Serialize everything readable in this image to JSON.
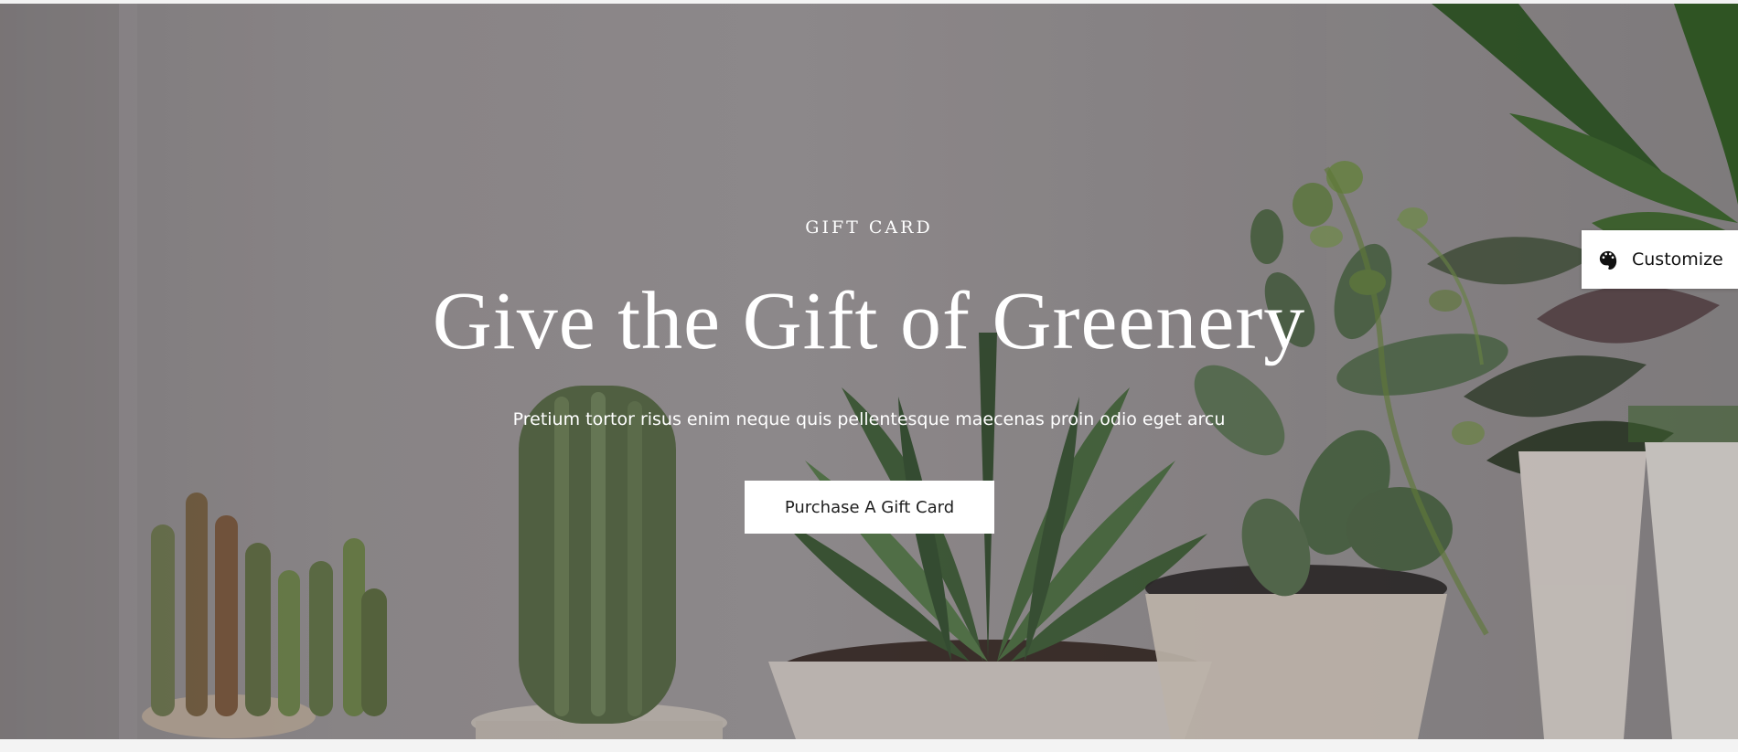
{
  "hero": {
    "eyebrow": "GIFT CARD",
    "title": "Give the Gift of Greenery",
    "subtitle": "Pretium tortor risus enim neque quis pellentesque maecenas proin odio eget arcu",
    "button_label": "Purchase A Gift Card"
  },
  "customize": {
    "label": "Customize",
    "icon": "palette-icon"
  },
  "colors": {
    "hero_text": "#ffffff",
    "button_background": "#ffffff",
    "button_text": "#1e1e1e",
    "page_background": "#f3f3f3"
  }
}
